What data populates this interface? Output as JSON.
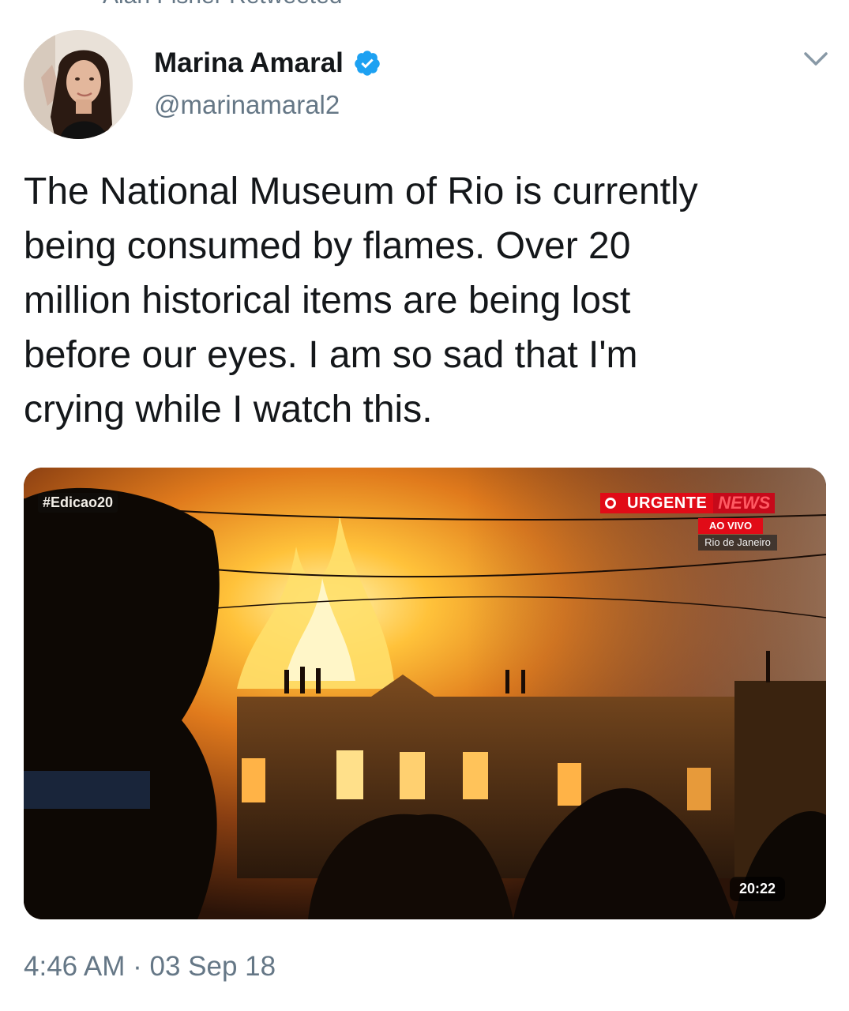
{
  "retweet_header": "Alan Fisher Retweeted",
  "author": {
    "display_name": "Marina Amaral",
    "handle": "@marinamaral2",
    "verified": true
  },
  "tweet": {
    "text_lines": [
      "The National Museum of Rio is currently",
      "being consumed by flames. Over 20",
      "million historical items are being lost",
      "before our eyes. I am so sad that I'm",
      "crying while I watch this."
    ]
  },
  "media": {
    "type": "video",
    "overlay_hashtag": "#Edicao20",
    "broadcast_urgent": "URGENTE",
    "broadcast_channel": "NEWS",
    "broadcast_live": "AO VIVO",
    "broadcast_location": "Rio de Janeiro",
    "duration": "20:22"
  },
  "meta": {
    "timestamp": "4:46 AM · 03 Sep 18"
  },
  "colors": {
    "verified": "#1da1f2",
    "secondary_text": "#657786",
    "urgent_red": "#e10b17"
  },
  "icons": {
    "verified": "verified-badge-icon",
    "menu": "chevron-down-icon"
  }
}
